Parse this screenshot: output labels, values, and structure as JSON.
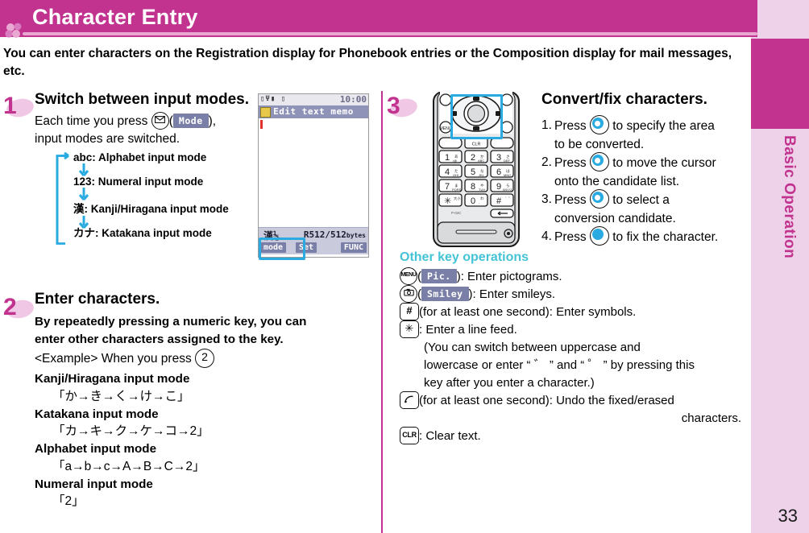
{
  "header": {
    "title": "Character Entry",
    "brand_color": "#c1338e",
    "clover_icon": "clover-icon"
  },
  "intro": "You can enter characters on the Registration display for Phonebook entries or the Composition display for mail messages, etc.",
  "side_rail": {
    "label": "Basic Operation",
    "page_number": "33",
    "bg_color": "#eed2ea",
    "tab_color": "#c1338e"
  },
  "step1": {
    "number": "1",
    "title": "Switch between input modes.",
    "line1_a": "Each time you press",
    "line1_key": "mail-key",
    "line1_softkey": "Mode",
    "line1_b": "),",
    "line2": "input modes are switched.",
    "modes": [
      "abc: Alphabet input mode",
      "123: Numeral input mode",
      "漢: Kanji/Hiragana input mode",
      "カナ: Katakana input mode"
    ]
  },
  "lcd": {
    "status_icons": "▯Ψ▮ ▯",
    "clock": "10:00",
    "title": "Edit text memo",
    "mode_indicator": "漢½",
    "bytes": "512/512",
    "bytes_unit": "bytes",
    "bytes_prefix": "R",
    "softkeys": {
      "left": "mode",
      "center": "Set",
      "right": "FUNC"
    }
  },
  "step2": {
    "number": "2",
    "title": "Enter characters.",
    "lead1": "By repeatedly pressing a numeric key, you can",
    "lead2": "enter other characters assigned to the key.",
    "example_prefix": "<Example> When you press",
    "example_key": "2",
    "modes": [
      {
        "name": "Kanji/Hiragana input mode",
        "sequence": "「か→き→く→け→こ」"
      },
      {
        "name": "Katakana input mode",
        "sequence": "「カ→キ→ク→ケ→コ→2」"
      },
      {
        "name": "Alphabet input mode",
        "sequence": "「a→b→c→A→B→C→2」"
      },
      {
        "name": "Numeral input mode",
        "sequence": "「2」"
      }
    ]
  },
  "step3": {
    "number": "3",
    "title": "Convert/fix characters.",
    "items": [
      {
        "index": "1.",
        "press": "Press",
        "key": "nav-left-right-key",
        "text_a": "to specify the area",
        "text_b": "to be converted."
      },
      {
        "index": "2.",
        "press": "Press",
        "key": "nav-down-key",
        "text_a": "to move the cursor",
        "text_b": "onto the candidate list."
      },
      {
        "index": "3.",
        "press": "Press",
        "key": "nav-up-down-key",
        "text_a": "to select a",
        "text_b": "conversion candidate."
      },
      {
        "index": "4.",
        "press": "Press",
        "key": "center-select-key",
        "text_a": "to fix the character.",
        "text_b": ""
      }
    ]
  },
  "other_key_operations": {
    "heading": "Other key operations",
    "lines": [
      {
        "key": "MENU",
        "key_type": "round",
        "softkey": "Pic.",
        "text": "): Enter pictograms."
      },
      {
        "key": "camera-tv-key",
        "key_type": "round-icon",
        "softkey": "Smiley",
        "text": "): Enter smileys."
      },
      {
        "key": "#",
        "key_type": "rect",
        "softkey": "",
        "text": "(for at least one second): Enter symbols."
      },
      {
        "key": "✳",
        "key_type": "rect",
        "softkey": "",
        "text": ": Enter a line feed."
      }
    ],
    "note_lines": [
      "(You can switch between uppercase and",
      "lowercase or enter “ ゛ ” and “ ゜ ” by pressing this",
      "key after you enter a character.)"
    ],
    "undo_line": {
      "key": "call-key",
      "text_a": "(for at least one second): Undo the fixed/erased",
      "text_b": "characters."
    },
    "clear_line": {
      "key": "CLR",
      "text": ": Clear text."
    }
  }
}
